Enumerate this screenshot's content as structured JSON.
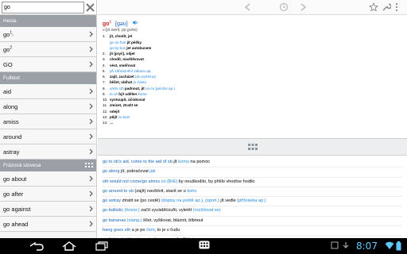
{
  "search": {
    "value": "go"
  },
  "sidebar": {
    "headwords_header": "Hesla",
    "headwords": [
      {
        "label": "go",
        "sup": "1"
      },
      {
        "label": "go",
        "sup": "2"
      },
      {
        "label": "GO",
        "sup": ""
      }
    ],
    "fulltext_header": "Fulltext",
    "fulltext": [
      "aid",
      "along",
      "amiss",
      "around",
      "astray"
    ],
    "phrases_header": "Frázová slovesa",
    "phrases": [
      "go about",
      "go after",
      "go against",
      "go ahead"
    ]
  },
  "entry": {
    "headword": "go",
    "superscript": "1",
    "pron": "[gəʊ]",
    "forms": "v.(pt went, pp gone)",
    "senses": [
      {
        "num": "1.",
        "parts": [
          {
            "t": "jít, chodit, jet",
            "c": "main"
          }
        ]
      },
      {
        "num": "",
        "parts": [
          {
            "t": "go on foot",
            "c": "sub"
          },
          {
            "t": " jít pěšky",
            "c": "main"
          }
        ]
      },
      {
        "num": "",
        "parts": [
          {
            "t": "go by bus",
            "c": "sub"
          },
          {
            "t": " jet autobusem",
            "c": "main"
          }
        ]
      },
      {
        "num": "2.",
        "parts": [
          {
            "t": "jít (pryč), odjet",
            "c": "main"
          }
        ]
      },
      {
        "num": "3.",
        "parts": [
          {
            "t": "chodit, navštěvovat",
            "c": "main"
          }
        ]
      },
      {
        "num": "4.",
        "parts": [
          {
            "t": "vést, směřovat",
            "c": "main"
          }
        ]
      },
      {
        "num": "5.",
        "parts": [
          {
            "t": "při zdůraznění zákazu ap.",
            "c": "sub"
          }
        ]
      },
      {
        "num": "6.",
        "parts": [
          {
            "t": "zajít, zacházet ",
            "c": "main"
          },
          {
            "t": "(do extrému)",
            "c": "sub"
          }
        ]
      },
      {
        "num": "7.",
        "parts": [
          {
            "t": "běžet, ubíhat ",
            "c": "main"
          },
          {
            "t": "(o čase)",
            "c": "sub"
          }
        ]
      },
      {
        "num": "8.",
        "parts": [
          {
            "t": "on/to sth",
            "c": "subi"
          },
          {
            "t": " padnout, jít ",
            "c": "main"
          },
          {
            "t": "na co",
            "c": "subi"
          },
          {
            "t": " (peníze ap.)",
            "c": "sub"
          }
        ]
      },
      {
        "num": "9.",
        "parts": [
          {
            "t": "to sb",
            "c": "subi"
          },
          {
            "t": " být udělen ",
            "c": "main"
          },
          {
            "t": "komu",
            "c": "subi"
          }
        ]
      },
      {
        "num": "10.",
        "parts": [
          {
            "t": "vystoupit, účinkovat",
            "c": "main"
          }
        ]
      },
      {
        "num": "11.",
        "parts": [
          {
            "t": "zmizet, ztratit se",
            "c": "main"
          }
        ]
      },
      {
        "num": "12.",
        "parts": [
          {
            "t": "odejít",
            "c": "main"
          }
        ]
      },
      {
        "num": "13.",
        "parts": [
          {
            "t": "pějít ",
            "c": "main"
          },
          {
            "t": "co kam",
            "c": "subi"
          }
        ]
      },
      {
        "num": "14.",
        "parts": [
          {
            "t": "…",
            "c": "main"
          }
        ]
      }
    ]
  },
  "phrase_list": [
    [
      {
        "t": "go to sb's aid, come to the aid of sb",
        "c": "en"
      },
      {
        "t": "  jít ",
        "c": "cz"
      },
      {
        "t": "komu",
        "c": "note"
      },
      {
        "t": " na pomoc",
        "c": "cz"
      }
    ],
    [
      {
        "t": "go along",
        "c": "en"
      },
      {
        "t": "  jít, pokračovat ",
        "c": "cz"
      },
      {
        "t": "jak",
        "c": "note"
      }
    ],
    [
      {
        "t": "sth would not come/go amiss",
        "c": "en"
      },
      {
        "t": "  co (BrE)",
        "c": "note"
      },
      {
        "t": " by neuškodilo, by přišlo vhod/se hodilo",
        "c": "cz"
      }
    ],
    [
      {
        "t": "go around to sb",
        "c": "en"
      },
      {
        "t": "  (zajít) navštívit, stavit se u ",
        "c": "cz"
      },
      {
        "t": "koho",
        "c": "note"
      }
    ],
    [
      {
        "t": "go astray",
        "c": "en"
      },
      {
        "t": "  ztratit se (po cestě) ",
        "c": "cz"
      },
      {
        "t": "(dopisy na poště ap.), (sport.)",
        "c": "note"
      },
      {
        "t": " jít vedle ",
        "c": "cz"
      },
      {
        "t": "(příhrávka ap.)",
        "c": "note"
      }
    ],
    [
      {
        "t": "go ballistic",
        "c": "en"
      },
      {
        "t": "  (hovor.)",
        "c": "note"
      },
      {
        "t": " začít vyvádět/zuřit, vyletět ",
        "c": "cz"
      },
      {
        "t": "(rozčilovat se)",
        "c": "note"
      }
    ],
    [
      {
        "t": "go bananas",
        "c": "en"
      },
      {
        "t": "  (slang.)",
        "c": "note"
      },
      {
        "t": " šílet, vyšilovat, bláznit, blbnout",
        "c": "cz"
      }
    ],
    [
      {
        "t": "bang goes sth",
        "c": "en"
      },
      {
        "t": "  a je po ",
        "c": "cz"
      },
      {
        "t": "čem",
        "c": "note"
      },
      {
        "t": ", to je v čudu",
        "c": "cz"
      }
    ],
    [
      {
        "t": "go (in) to bat for sb",
        "c": "en"
      },
      {
        "t": "  postavit se za, podpořit ",
        "c": "cz"
      },
      {
        "t": "koho",
        "c": "note"
      }
    ],
    [
      {
        "t": "go halloo",
        "c": "en"
      },
      {
        "t": "  (hovor.) ...",
        "c": "note"
      }
    ]
  ],
  "statusbar": {
    "time": "8:07"
  }
}
